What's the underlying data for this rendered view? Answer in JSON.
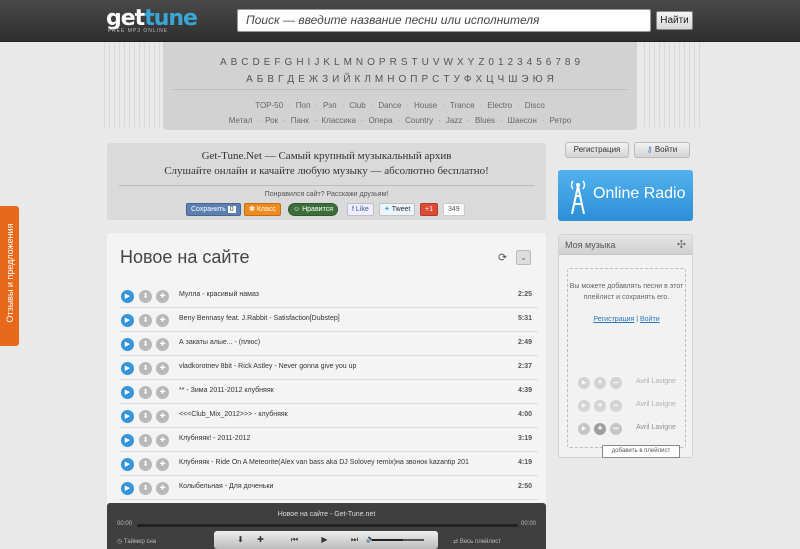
{
  "header": {
    "logo_part1": "get",
    "logo_part2": "tune",
    "logo_sub": "FREE MP3 ONLINE",
    "search_placeholder": "Поиск — введите название песни или исполнителя",
    "search_button": "Найти"
  },
  "alphabet": {
    "latin": [
      "A",
      "B",
      "C",
      "D",
      "E",
      "F",
      "G",
      "H",
      "I",
      "J",
      "K",
      "L",
      "M",
      "N",
      "O",
      "P",
      "R",
      "S",
      "T",
      "U",
      "V",
      "W",
      "X",
      "Y",
      "Z",
      "0",
      "1",
      "2",
      "3",
      "4",
      "5",
      "6",
      "7",
      "8",
      "9"
    ],
    "cyrillic": [
      "А",
      "Б",
      "В",
      "Г",
      "Д",
      "Е",
      "Ж",
      "З",
      "И",
      "Й",
      "К",
      "Л",
      "М",
      "Н",
      "О",
      "П",
      "Р",
      "С",
      "Т",
      "У",
      "Ф",
      "Х",
      "Ц",
      "Ч",
      "Ш",
      "Э",
      "Ю",
      "Я"
    ]
  },
  "genres": {
    "row1": [
      "TOP-50",
      "Поп",
      "Рэп",
      "Club",
      "Dance",
      "House",
      "Trance",
      "Electro",
      "Disco"
    ],
    "row2": [
      "Метал",
      "Рок",
      "Панк",
      "Классика",
      "Опера",
      "Country",
      "Jazz",
      "Blues",
      "Шансон",
      "Ретро"
    ]
  },
  "promo": {
    "line1": "Get-Tune.Net — Самый крупный музыкальный архив",
    "line2": "Слушайте онлайн и качайте любую музыку — абсолютно бесплатно!",
    "share_text": "Понравился сайт? Расскажи друзьям!",
    "buttons": {
      "save": "Сохранить",
      "save_count": "0",
      "klass": "Класс",
      "like": "Нравится",
      "fb_like": "Like",
      "tweet": "Tweet",
      "gplus": "+1",
      "gplus_count": "349"
    }
  },
  "main": {
    "title": "Новое на сайте",
    "tracks": [
      {
        "title": "Мулла - красивый намаз",
        "duration": "2:25"
      },
      {
        "title": "Beny Bennasy feat. J.Rabbit - Satisfaction[Dubstep]",
        "duration": "5:31"
      },
      {
        "title": "А закаты алые... - (плюс)",
        "duration": "2:49"
      },
      {
        "title": "vladkorotnev 8bit - Rick Astley - Never gonna give you up",
        "duration": "2:37"
      },
      {
        "title": "** - Зима 2011-2012 клубняяк",
        "duration": "4:39"
      },
      {
        "title": "<<<Club_Mix_2012>>> - клубняяк",
        "duration": "4:00"
      },
      {
        "title": "Клубняяк! - 2011-2012",
        "duration": "3:19"
      },
      {
        "title": "Клубняяк - Ride On A Meteorite(Alex van bass aka DJ Solovey remix)на звонок kazantip 201",
        "duration": "4:19"
      },
      {
        "title": "Колыбельная - Для доченьки",
        "duration": "2:50"
      }
    ]
  },
  "player": {
    "title": "Новое на сайте - Get-Tune.net",
    "time_left": "00:00",
    "time_right": "00:00",
    "sleep_timer": "Таймер сна",
    "whole_playlist": "Весь плейлист",
    "volume": 0.6
  },
  "auth": {
    "register": "Регистрация",
    "login": "Войти"
  },
  "radio": {
    "label": "Online Radio"
  },
  "mymusic": {
    "title": "Моя музыка",
    "text": "Вы можете добавлять песни в этот плейлист и сохранять его.",
    "register_link": "Регистрация",
    "login_link": "Войти",
    "ghost_label": "Avril Lavigne",
    "tooltip": "добавить в плейлист"
  },
  "feedback": {
    "label": "Отзывы и предложения"
  },
  "colors": {
    "accent": "#3496d8",
    "feedback": "#e8691b",
    "radio": "#3ea0e4"
  }
}
